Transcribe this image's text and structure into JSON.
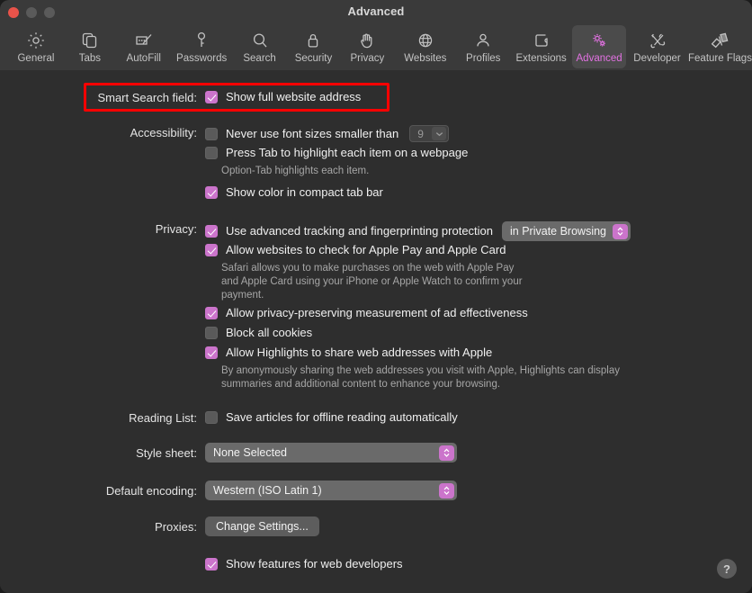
{
  "window": {
    "title": "Advanced",
    "traffic_lights": [
      "close",
      "minimize",
      "zoom"
    ]
  },
  "toolbar": {
    "items": [
      {
        "label": "General",
        "icon": "gear-icon",
        "selected": false
      },
      {
        "label": "Tabs",
        "icon": "tabs-icon",
        "selected": false
      },
      {
        "label": "AutoFill",
        "icon": "autofill-icon",
        "selected": false
      },
      {
        "label": "Passwords",
        "icon": "key-icon",
        "selected": false
      },
      {
        "label": "Search",
        "icon": "magnifier-icon",
        "selected": false
      },
      {
        "label": "Security",
        "icon": "lock-icon",
        "selected": false
      },
      {
        "label": "Privacy",
        "icon": "hand-icon",
        "selected": false
      },
      {
        "label": "Websites",
        "icon": "globe-icon",
        "selected": false
      },
      {
        "label": "Profiles",
        "icon": "person-icon",
        "selected": false
      },
      {
        "label": "Extensions",
        "icon": "puzzle-icon",
        "selected": false
      },
      {
        "label": "Advanced",
        "icon": "gears-icon",
        "selected": true
      },
      {
        "label": "Developer",
        "icon": "tools-icon",
        "selected": false
      },
      {
        "label": "Feature Flags",
        "icon": "flags-icon",
        "selected": false
      }
    ]
  },
  "settings": {
    "smart_search": {
      "label": "Smart Search field:",
      "show_full_address": {
        "label": "Show full website address",
        "checked": true
      },
      "highlighted": true
    },
    "accessibility": {
      "label": "Accessibility:",
      "never_small_fonts": {
        "label": "Never use font sizes smaller than",
        "checked": false
      },
      "font_size_value": "9",
      "press_tab": {
        "label": "Press Tab to highlight each item on a webpage",
        "checked": false
      },
      "press_tab_hint": "Option-Tab highlights each item.",
      "compact_tab_color": {
        "label": "Show color in compact tab bar",
        "checked": true
      }
    },
    "privacy": {
      "label": "Privacy:",
      "tracking_protection": {
        "label": "Use advanced tracking and fingerprinting protection",
        "checked": true
      },
      "tracking_scope": "in Private Browsing",
      "apple_pay": {
        "label": "Allow websites to check for Apple Pay and Apple Card",
        "checked": true
      },
      "apple_pay_hint_line1": "Safari allows you to make purchases on the web with Apple Pay",
      "apple_pay_hint_line2": "and Apple Card using your iPhone or Apple Watch to confirm your",
      "apple_pay_hint_line3": "payment.",
      "ad_measurement": {
        "label": "Allow privacy-preserving measurement of ad effectiveness",
        "checked": true
      },
      "block_cookies": {
        "label": "Block all cookies",
        "checked": false
      },
      "highlights_share": {
        "label": "Allow Highlights to share web addresses with Apple",
        "checked": true
      },
      "highlights_hint_line1": "By anonymously sharing the web addresses you visit with Apple, Highlights can display",
      "highlights_hint_line2": "summaries and additional content to enhance your browsing."
    },
    "reading_list": {
      "label": "Reading List:",
      "save_offline": {
        "label": "Save articles for offline reading automatically",
        "checked": false
      }
    },
    "style_sheet": {
      "label": "Style sheet:",
      "value": "None Selected"
    },
    "default_encoding": {
      "label": "Default encoding:",
      "value": "Western (ISO Latin 1)"
    },
    "proxies": {
      "label": "Proxies:",
      "button_label": "Change Settings..."
    },
    "web_developers": {
      "label": "Show features for web developers",
      "checked": true
    }
  },
  "help": {
    "label": "?"
  },
  "colors": {
    "accent": "#cb74cb",
    "window_bg": "#2e2e2e",
    "titlebar_bg": "#3a3a3a",
    "annotation": "#fe0000",
    "text": "#f0f0f0",
    "subtext": "#a6a6a6"
  }
}
